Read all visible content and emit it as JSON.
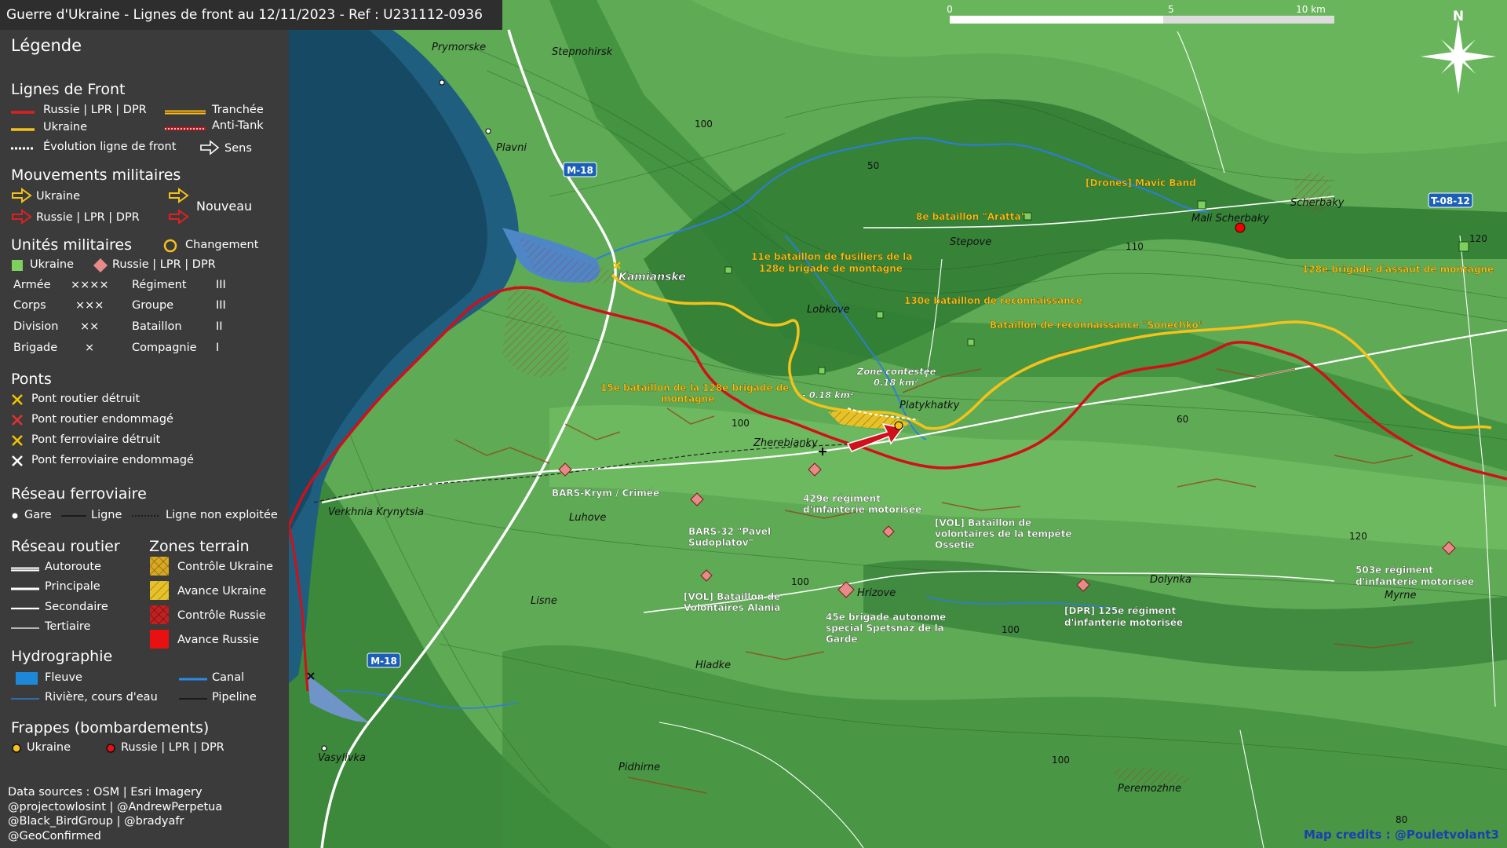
{
  "title": "Guerre d'Ukraine - Lignes de front au 12/11/2023 - Ref : U231112-0936",
  "scale": {
    "l0": "0",
    "l5": "5",
    "l10": "10 km"
  },
  "north": "N",
  "legend": {
    "title": "Légende",
    "front": {
      "title": "Lignes de Front",
      "russia": "Russie | LPR | DPR",
      "ukraine": "Ukraine",
      "evolution": "Évolution ligne de front",
      "trench": "Tranchée",
      "antitank": "Anti-Tank",
      "direction": "Sens"
    },
    "moves": {
      "title": "Mouvements militaires",
      "ukraine": "Ukraine",
      "russia": "Russie | LPR | DPR",
      "new": "Nouveau"
    },
    "units": {
      "title": "Unités militaires",
      "change": "Changement",
      "ukraine": "Ukraine",
      "russia": "Russie | LPR | DPR",
      "rows": [
        {
          "a": "Armée",
          "as": "××××",
          "b": "Régiment",
          "bs": "III"
        },
        {
          "a": "Corps",
          "as": "×××",
          "b": "Groupe",
          "bs": "III"
        },
        {
          "a": "Division",
          "as": "××",
          "b": "Bataillon",
          "bs": "II"
        },
        {
          "a": "Brigade",
          "as": "×",
          "b": "Compagnie",
          "bs": "I"
        }
      ]
    },
    "bridges": {
      "title": "Ponts",
      "items": [
        "Pont routier détruit",
        "Pont routier endommagé",
        "Pont ferroviaire détruit",
        "Pont ferroviaire endommagé"
      ],
      "colors": [
        "#f2c200",
        "#e83030",
        "#f2c200",
        "#ffffff"
      ]
    },
    "rail": {
      "title": "Réseau ferroviaire",
      "station": "Gare",
      "line": "Ligne",
      "unused": "Ligne non exploitée"
    },
    "roads": {
      "title": "Réseau routier",
      "items": [
        "Autoroute",
        "Principale",
        "Secondaire",
        "Tertiaire"
      ]
    },
    "zones": {
      "title": "Zones terrain",
      "items": [
        "Contrôle Ukraine",
        "Avance Ukraine",
        "Contrôle Russie",
        "Avance Russie"
      ]
    },
    "hydro": {
      "title": "Hydrographie",
      "river_big": "Fleuve",
      "canal": "Canal",
      "river": "Rivière, cours d'eau",
      "pipeline": "Pipeline"
    },
    "strikes": {
      "title": "Frappes (bombardements)",
      "ukraine": "Ukraine",
      "russia": "Russie | LPR | DPR"
    },
    "sources": [
      "Data sources : OSM | Esri Imagery",
      "@projectowlosint | @AndrewPerpetua",
      "@Black_BirdGroup | @bradyafr",
      "@GeoConfirmed"
    ]
  },
  "map": {
    "places": {
      "prymorske": "Prymorske",
      "stepnohirsk": "Stepnohirsk",
      "plavni": "Plavni",
      "kamianske": "Kamianske",
      "lobkove": "Lobkove",
      "stepove": "Stepove",
      "mali": "Mali Scherbaky",
      "scherbaky": "Scherbaky",
      "platy": "Platykhatky",
      "zherebianky": "Zherebianky",
      "verkhnia": "Verkhnia Krynytsia",
      "luhove": "Luhove",
      "lisne": "Lisne",
      "hrizove": "Hrizove",
      "dolynka": "Dolynka",
      "myrne": "Myrne",
      "hladke": "Hladke",
      "vasylivka": "Vasylivka",
      "pidhirne": "Pidhirne",
      "peremozhne": "Peremozhne"
    },
    "roads": {
      "m18a": "M-18",
      "m18b": "M-18",
      "t0812": "T-08-12"
    },
    "contours": {
      "c100a": "100",
      "c50": "50",
      "c110": "110",
      "c120a": "120",
      "c100b": "100",
      "c60": "60",
      "c120b": "120",
      "c100c": "100",
      "c100d": "100",
      "c100e": "100",
      "c80": "80"
    },
    "units_ua": {
      "drones": "[Drones] Mavic Band",
      "aratta": "8e bataillon \"Aratta\"",
      "u11a": "11e bataillon de fusiliers de la",
      "u11b": "128e brigade de montagne",
      "u130": "130e bataillon de reconnaissance",
      "sonechko": "Bataillon de reconnaissance \"Sonechko\"",
      "u128": "128e brigade d'assaut de montagne",
      "u15a": "15e bataillon de la 128e brigade de",
      "u15b": "montagne"
    },
    "units_ru": {
      "bars_krym": "BARS-Krym / Crimée",
      "bars32a": "BARS-32 \"Pavel",
      "bars32b": "Sudoplatov\"",
      "r429a": "429e régiment",
      "r429b": "d'infanterie motorisée",
      "volta": "[VOL] Bataillon de",
      "voltb": "volontaires de la tempête",
      "voltc": "Ossétie",
      "alania_a": "[VOL] Bataillon de",
      "alania_b": "Volontaires Alania",
      "b45a": "45e brigade autonome",
      "b45b": "spécial Spetsnaz de la",
      "b45c": "Garde",
      "dpr125a": "[DPR] 125e régiment",
      "dpr125b": "d'infanterie motorisée",
      "r503a": "503e régiment",
      "r503b": "d'infanterie motorisée"
    },
    "contested": {
      "a": "Zone contestée",
      "b": "0.18 km²",
      "loss": "- 0.18 km²"
    },
    "credit": "Map credits : @Pouletvolant3"
  },
  "colors": {
    "russia": "#d0101a",
    "ukraine": "#f4c21a",
    "water": "#1e5b7a",
    "label_ua": "#f4c21a"
  }
}
